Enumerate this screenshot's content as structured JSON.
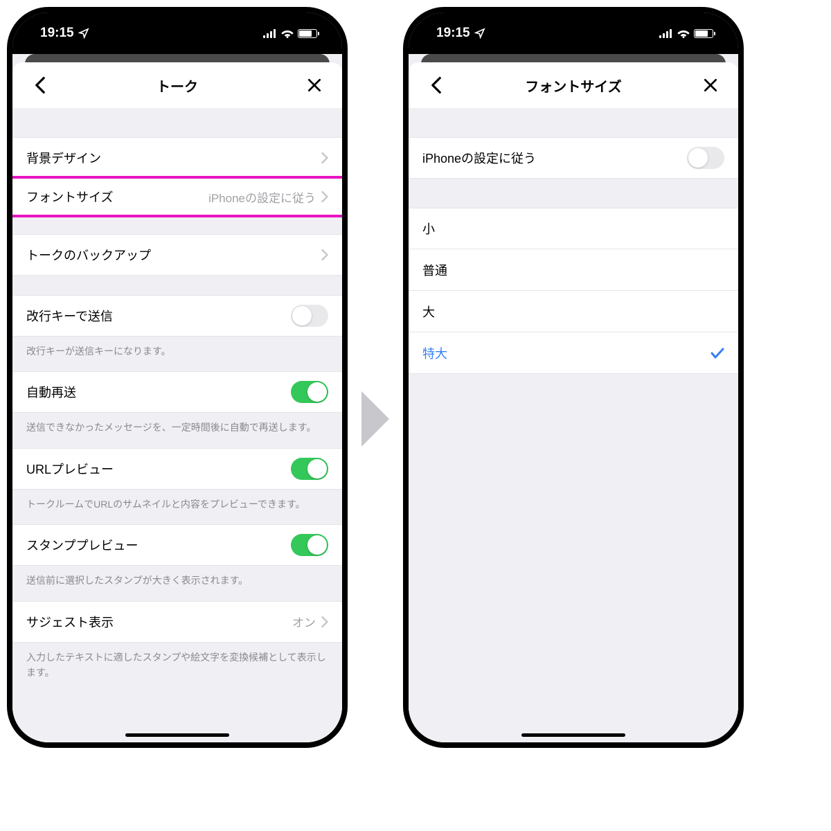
{
  "statusbar": {
    "time": "19:15"
  },
  "screen1": {
    "title": "トーク",
    "items": {
      "background_design": "背景デザイン",
      "font_size": "フォントサイズ",
      "font_size_value": "iPhoneの設定に従う",
      "talk_backup": "トークのバックアップ",
      "enter_to_send": "改行キーで送信",
      "enter_to_send_desc": "改行キーが送信キーになります。",
      "auto_resend": "自動再送",
      "auto_resend_desc": "送信できなかったメッセージを、一定時間後に自動で再送します。",
      "url_preview": "URLプレビュー",
      "url_preview_desc": "トークルームでURLのサムネイルと内容をプレビューできます。",
      "stamp_preview": "スタンププレビュー",
      "stamp_preview_desc": "送信前に選択したスタンプが大きく表示されます。",
      "suggest": "サジェスト表示",
      "suggest_value": "オン",
      "suggest_desc": "入力したテキストに適したスタンプや絵文字を変換候補として表示します。"
    }
  },
  "screen2": {
    "title": "フォントサイズ",
    "follow_iphone": "iPhoneの設定に従う",
    "options": {
      "small": "小",
      "normal": "普通",
      "large": "大",
      "xlarge": "特大"
    }
  }
}
